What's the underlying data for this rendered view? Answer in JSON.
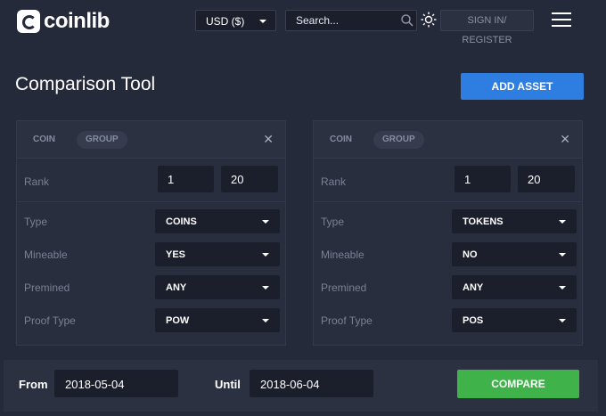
{
  "header": {
    "logo_text": "coinlib",
    "currency": "USD ($)",
    "search_placeholder": "Search...",
    "signin_label": "SIGN IN/ REGISTER"
  },
  "page": {
    "title": "Comparison Tool",
    "add_asset_label": "ADD ASSET"
  },
  "cards": [
    {
      "tab_coin": "COIN",
      "tab_group": "GROUP",
      "rank_label": "Rank",
      "rank_from": "1",
      "rank_to": "20",
      "type_label": "Type",
      "type_value": "COINS",
      "mineable_label": "Mineable",
      "mineable_value": "YES",
      "premined_label": "Premined",
      "premined_value": "ANY",
      "proof_label": "Proof Type",
      "proof_value": "POW"
    },
    {
      "tab_coin": "COIN",
      "tab_group": "GROUP",
      "rank_label": "Rank",
      "rank_from": "1",
      "rank_to": "20",
      "type_label": "Type",
      "type_value": "TOKENS",
      "mineable_label": "Mineable",
      "mineable_value": "NO",
      "premined_label": "Premined",
      "premined_value": "ANY",
      "proof_label": "Proof Type",
      "proof_value": "POS"
    }
  ],
  "footer": {
    "from_label": "From",
    "from_date": "2018-05-04",
    "until_label": "Until",
    "until_date": "2018-06-04",
    "compare_label": "COMPARE"
  },
  "colors": {
    "accent_blue": "#2d7ee0",
    "compare_green": "#3fb34a",
    "background": "#252a3a"
  },
  "icons": [
    "logo-icon",
    "chevron-down-icon",
    "search-icon",
    "sun-icon",
    "menu-icon",
    "close-icon"
  ]
}
